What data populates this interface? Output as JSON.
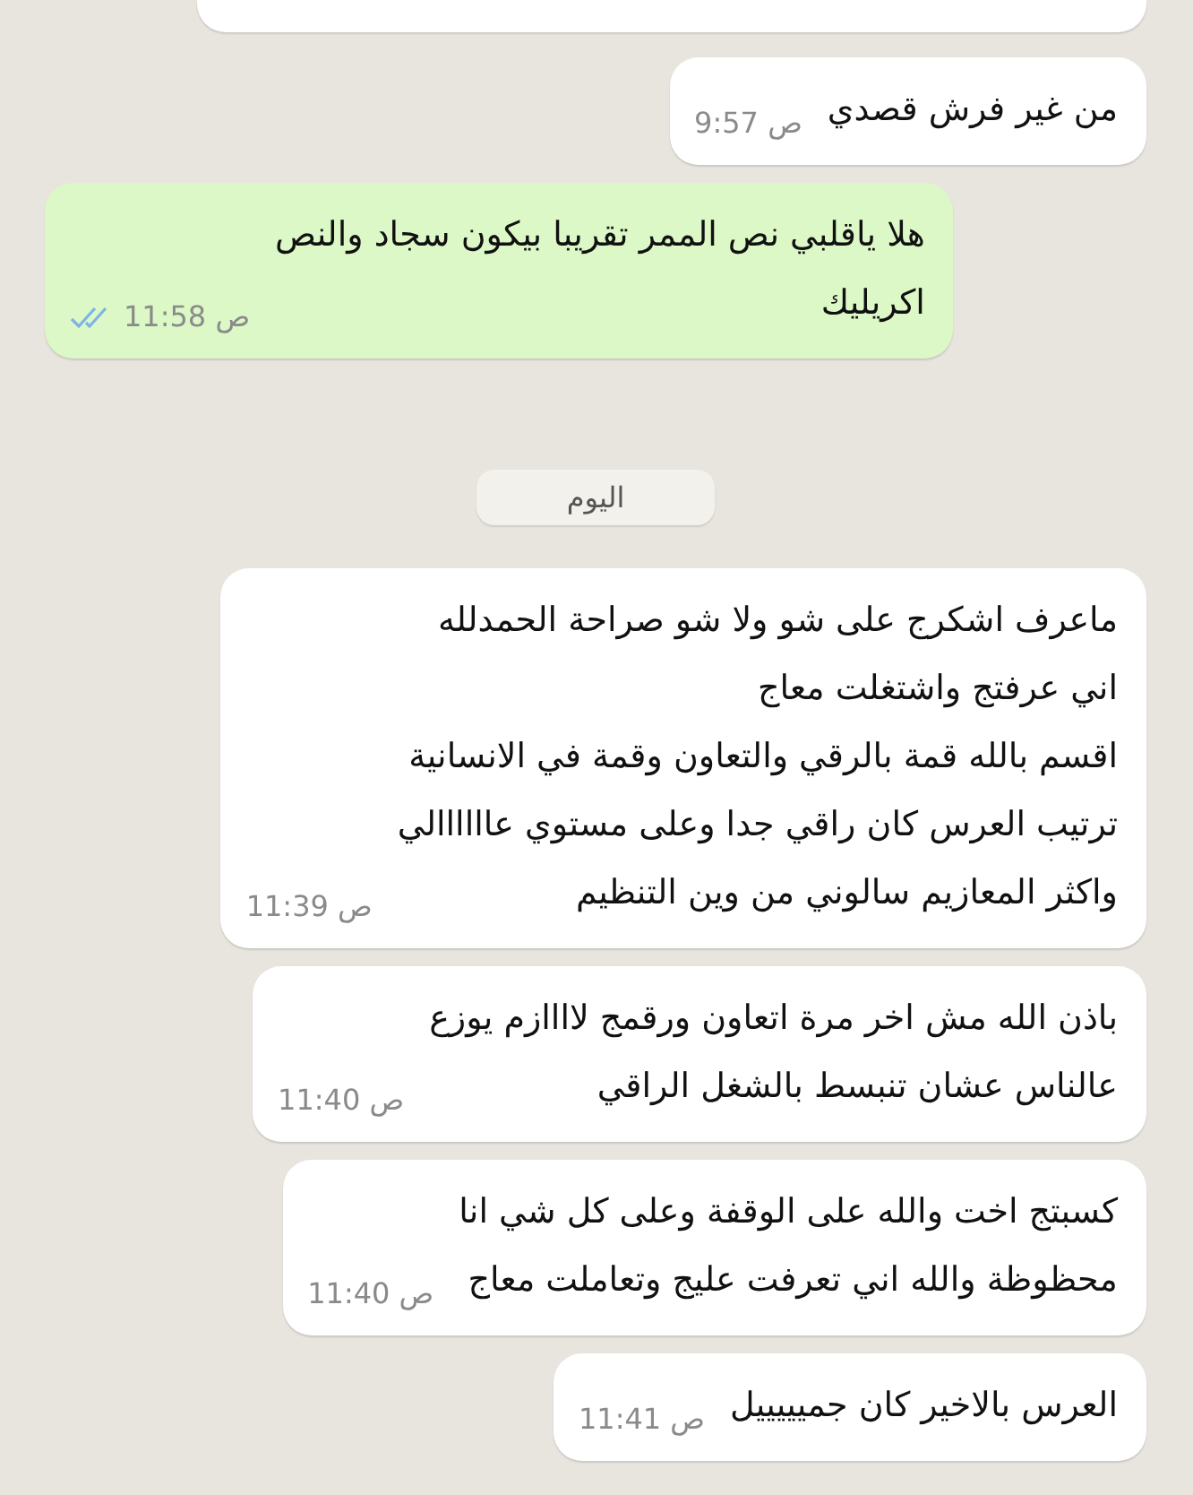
{
  "partial_bubble_above": true,
  "messages": [
    {
      "kind": "incoming",
      "text": "من غير فرش قصدي",
      "time": "ص 9:57"
    },
    {
      "kind": "outgoing",
      "text": "هلا ياقلبي نص الممر تقريبا  بيكون سجاد والنص\nاكريليك",
      "time": "ص 11:58",
      "read": true
    },
    {
      "kind": "date",
      "text": "اليوم"
    },
    {
      "kind": "incoming",
      "text": "ماعرف اشكرج على شو ولا شو صراحة الحمدلله\nاني عرفتج واشتغلت معاج\nاقسم بالله قمة بالرقي والتعاون وقمة في الانسانية\nترتيب العرس كان راقي جدا وعلى مستوي عاااااالي\nواكثر المعازيم سالوني من وين التنظيم",
      "time": "ص 11:39"
    },
    {
      "kind": "incoming",
      "text": "باذن الله مش اخر مرة اتعاون ورقمج لاااازم يوزع\nعالناس عشان تنبسط بالشغل الراقي",
      "time": "ص 11:40"
    },
    {
      "kind": "incoming",
      "text": "كسبتج اخت والله على الوقفة وعلى كل شي انا\nمحظوظة والله اني تعرفت عليج وتعاملت معاج",
      "time": "ص 11:40"
    },
    {
      "kind": "incoming",
      "text": "العرس بالاخير كان جميييييل",
      "time": "ص 11:41"
    }
  ]
}
